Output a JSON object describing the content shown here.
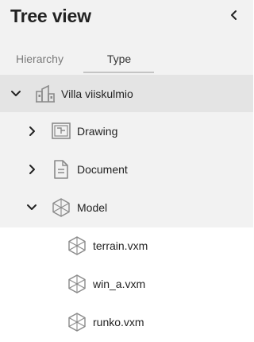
{
  "header": {
    "title": "Tree view",
    "collapse_icon": "chevron-left-icon"
  },
  "tabs": [
    {
      "label": "Hierarchy",
      "active": false
    },
    {
      "label": "Type",
      "active": true
    }
  ],
  "tree": {
    "root": {
      "label": "Villa viiskulmio",
      "icon": "building-icon",
      "expanded": true
    },
    "children": [
      {
        "label": "Drawing",
        "icon": "drawing-icon",
        "expanded": false
      },
      {
        "label": "Document",
        "icon": "document-icon",
        "expanded": false
      },
      {
        "label": "Model",
        "icon": "cube-icon",
        "expanded": true,
        "children": [
          {
            "label": "terrain.vxm",
            "icon": "cube-icon"
          },
          {
            "label": "win_a.vxm",
            "icon": "cube-icon"
          },
          {
            "label": "runko.vxm",
            "icon": "cube-icon"
          }
        ]
      }
    ]
  },
  "colors": {
    "panel_background": "#f2f2f2",
    "selected_row": "#e4e4e4",
    "icon_gray": "#8a8a8a",
    "text": "#222222"
  }
}
